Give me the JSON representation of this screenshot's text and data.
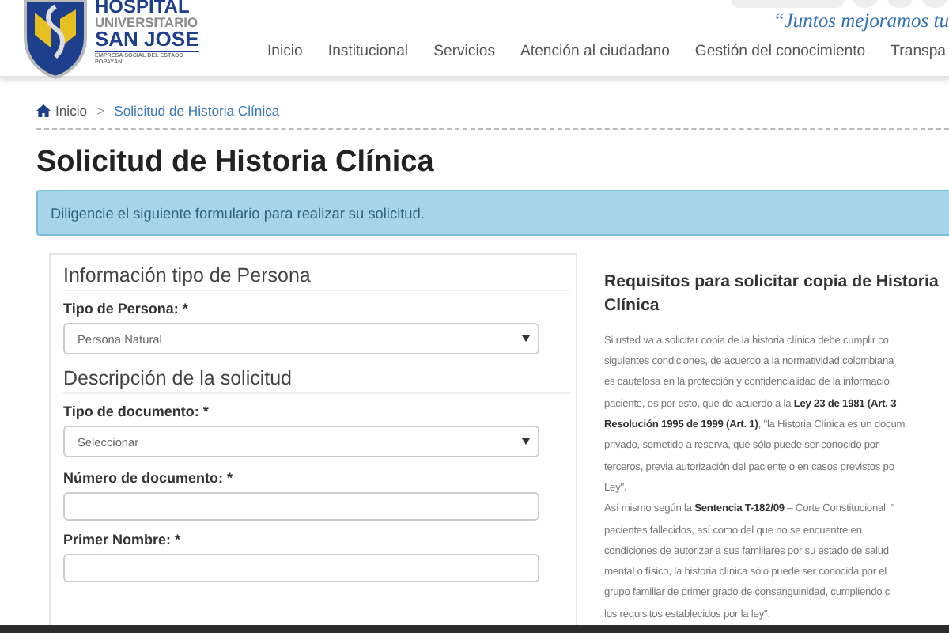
{
  "header": {
    "logo": {
      "name": "HOSPITAL",
      "subname": "UNIVERSITARIO",
      "place_name": "SAN JOSE",
      "tagline": "EMPRESA SOCIAL DEL ESTADO",
      "city": "POPAYÁN"
    },
    "slogan": "“Juntos mejoramos tu",
    "nav": [
      {
        "label": "Inicio"
      },
      {
        "label": "Institucional"
      },
      {
        "label": "Servicios"
      },
      {
        "label": "Atención al ciudadano"
      },
      {
        "label": "Gestión del conocimiento"
      },
      {
        "label": "Transpa"
      }
    ]
  },
  "breadcrumb": {
    "items": [
      {
        "label": "Inicio",
        "kind": "home"
      },
      {
        "label": "Solicitud de Historia Clínica",
        "kind": "link"
      }
    ],
    "separator": ">"
  },
  "title": "Solicitud de Historia Clínica",
  "alert": "Diligencie el siguiente formulario para realizar su solicitud.",
  "form": {
    "sections": [
      {
        "title": "Información tipo de Persona",
        "fields": [
          {
            "label": "Tipo de Persona: *",
            "kind": "select",
            "value": "Persona Natural"
          }
        ]
      },
      {
        "title": "Descripción de la solicitud",
        "fields": [
          {
            "label": "Tipo de documento: *",
            "kind": "select",
            "value": "Seleccionar"
          },
          {
            "label": "Número de documento: *",
            "kind": "text"
          },
          {
            "label": "Primer Nombre: *",
            "kind": "text"
          }
        ]
      }
    ]
  },
  "requirements": {
    "title": "Requisitos para solicitar copia de Historia Clínica",
    "lines": [
      "Si usted va a solicitar copia de la historia clínica debe cumplir co",
      "siguientes condiciones, de acuerdo a la normatividad colombiana",
      "es cautelosa en la protección y confidencialidad de la informació",
      "paciente, es por esto, que de acuerdo a la **Ley 23 de 1981 (Art. 3**",
      "**Resolución 1995 de 1999 (Art. 1)**, \"la Historia Clínica es un docum",
      "privado, sometido a reserva, que sólo puede ser conocido por",
      "terceros, previa autorización del paciente o en casos previstos po",
      "Ley\".",
      "Así mismo según la **Sentencia T-182/09** – Corte Constitucional: \"",
      "pacientes fallecidos, así como del que no se encuentre en",
      "condiciones de autorizar a sus familiares por su estado de salud",
      "mental o físico, la historia clínica sólo puede ser conocida por el",
      "grupo familiar  de primer grado de consanguinidad, cumpliendo c",
      "los requisitos establecidos por la ley\"."
    ]
  }
}
